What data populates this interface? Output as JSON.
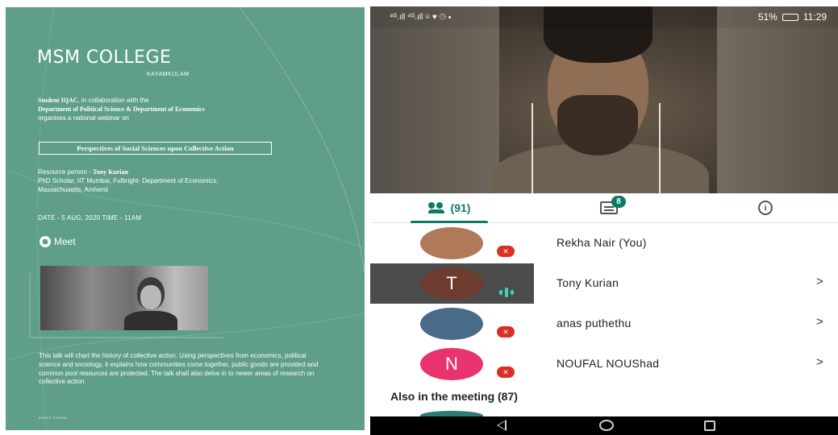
{
  "poster": {
    "title": "MSM COLLEGE",
    "subtitle": "KAYAMKULAM",
    "org_line1_bold": "Student IQAC",
    "org_line1_rest": ", in collaboration with the",
    "org_line2": "Department of Political Science & Department of Economics",
    "org_line3": "organises a national webinar on",
    "topic": "Perspectives of Social Sciences upon Collective Action",
    "resource_prefix": "Resource person - ",
    "resource_name": "Tony Kurian",
    "resource_line2": "PhD Scholar, IIT Mumbai, Fulbright- Department of Economics,",
    "resource_line3": "Massachusetts, Amherst",
    "date_time": "DATE - 5 AUG, 2020   TIME - 11AM",
    "meet_label": "Meet",
    "description": "This talk will chart the history of collective action. Using perspectives from economics, political science and sociology, it explains how communities come together, public goods are provided and common pool resources are protected. The talk shall also delve in to newer areas of research on collective action.",
    "brand": "EVENS STUDIO",
    "colors": {
      "background": "#5f9e8a",
      "text": "#ffffff"
    }
  },
  "phone": {
    "status_bar": {
      "left_indicators": "⁴ᴳ.ıll ⁴ᴳ.ıll ⌾ ♥ ◷ ◂",
      "battery_text": "51%",
      "time": "11:29"
    },
    "tabs": {
      "people_count": "(91)",
      "chat_badge": "8",
      "info_glyph": "i"
    },
    "participants": [
      {
        "name": "Rekha Nair (You)",
        "avatar_color": "#b07a5a",
        "avatar_letter": "",
        "muted": true,
        "speaking": false,
        "active": false,
        "chevron": ""
      },
      {
        "name": "Tony Kurian",
        "avatar_color": "#6e3b2f",
        "avatar_letter": "T",
        "muted": false,
        "speaking": true,
        "active": true,
        "chevron": ">"
      },
      {
        "name": "anas puthethu",
        "avatar_color": "#4a6a8a",
        "avatar_letter": "",
        "muted": true,
        "speaking": false,
        "active": false,
        "chevron": ">"
      },
      {
        "name": "NOUFAL NOUShad",
        "avatar_color": "#e8336d",
        "avatar_letter": "N",
        "muted": true,
        "speaking": false,
        "active": false,
        "chevron": ">"
      }
    ],
    "also_in_meeting": "Also in the meeting (87)",
    "mute_glyph": "✕",
    "accent_color": "#0b7a66"
  }
}
